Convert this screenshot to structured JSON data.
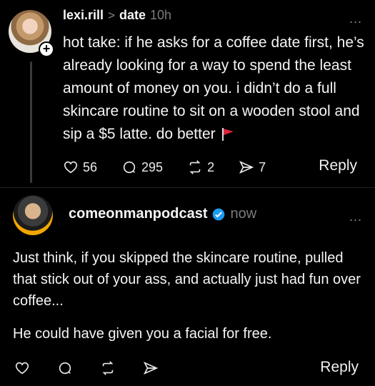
{
  "post": {
    "username": "lexi.rill",
    "crumb_separator": ">",
    "crumb": "date",
    "time": "10h",
    "more": "...",
    "plus": "+",
    "text": "hot take: if he asks for a coffee date first, he’s already looking for a way to spend the least amount of money on you. i didn’t do a full skincare routine to sit on a wooden stool and sip a $5 latte. do better",
    "flag_icon": "red-flag-icon",
    "likes": "56",
    "comments": "295",
    "reposts": "2",
    "shares": "7",
    "reply_label": "Reply"
  },
  "reply_post": {
    "username": "comeonmanpodcast",
    "time": "now",
    "more": "...",
    "verified_icon": "verified-badge-icon",
    "verified_color": "#1d9bf0",
    "paragraphs": [
      "Just think, if you skipped the skincare routine, pulled that stick out of your ass, and actually just had fun over coffee...",
      "He could have given you a facial for free."
    ],
    "reply_label": "Reply"
  }
}
